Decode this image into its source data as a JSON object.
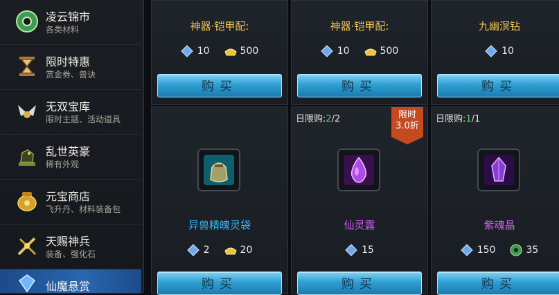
{
  "sidebar": {
    "items": [
      {
        "title": "凌云锦市",
        "sub": "各类材料"
      },
      {
        "title": "限时特惠",
        "sub": "赏金券、兽诀"
      },
      {
        "title": "无双宝库",
        "sub": "限时主题、活动道具"
      },
      {
        "title": "乱世英豪",
        "sub": "稀有外观"
      },
      {
        "title": "元宝商店",
        "sub": "飞升丹、材料装备包"
      },
      {
        "title": "天赐神兵",
        "sub": "装备、强化石"
      },
      {
        "title": "仙魔悬赏",
        "sub": ""
      }
    ]
  },
  "shop": {
    "buy_label": "购买",
    "row1": [
      {
        "name": "神器·铠甲配:",
        "cost1": "10",
        "cost2": "500"
      },
      {
        "name": "神器·铠甲配:",
        "cost1": "10",
        "cost2": "500"
      },
      {
        "name": "九幽溟钻",
        "cost1": "10",
        "cost2": ""
      }
    ],
    "row2": [
      {
        "name": "异兽精魄灵袋",
        "limit_label": "",
        "limit_bought": "",
        "limit_total": "",
        "cost1": "2",
        "cost2": "20",
        "cost2_icon": "gold-ingot-icon",
        "badge_line1": "",
        "badge_line2": ""
      },
      {
        "name": "仙灵露",
        "limit_label": "日限购:",
        "limit_bought": "2",
        "limit_total": "/2",
        "cost1": "15",
        "cost2": "",
        "cost2_icon": "",
        "badge_line1": "限时",
        "badge_line2": "3.0折"
      },
      {
        "name": "紫魂晶",
        "limit_label": "日限购:",
        "limit_bought": "1",
        "limit_total": "/1",
        "cost1": "150",
        "cost2": "35",
        "cost2_icon": "jade-coin-icon",
        "badge_line1": "",
        "badge_line2": ""
      }
    ]
  },
  "colors": {
    "gold_name": "#f3c64b",
    "cyan_name": "#3bb6ee",
    "purple_name": "#d05cf0",
    "limit_green": "#5ed36a"
  }
}
